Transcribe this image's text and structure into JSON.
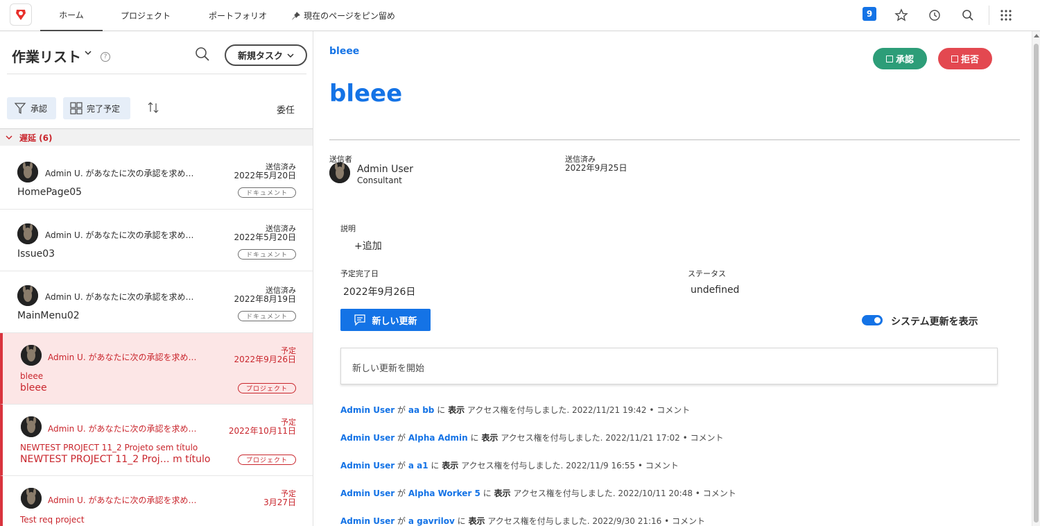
{
  "nav": {
    "tabs": [
      "ホーム",
      "プロジェクト",
      "ポートフォリオ"
    ],
    "pin_label": "現在のページをピン留め",
    "badge_count": "9"
  },
  "worklist": {
    "title": "作業リスト",
    "new_task": "新規タスク",
    "filter_approval": "承認",
    "filter_due": "完了予定",
    "delegate": "委任",
    "group_label": "遅延 (6)",
    "items": [
      {
        "msg": "Admin U. があなたに次の承認を求め…",
        "status1": "送信済み",
        "status2": "2022年5月20日",
        "name": "HomePage05",
        "tag": "ドキュメント"
      },
      {
        "msg": "Admin U. があなたに次の承認を求め…",
        "status1": "送信済み",
        "status2": "2022年5月20日",
        "name": "Issue03",
        "tag": "ドキュメント"
      },
      {
        "msg": "Admin U. があなたに次の承認を求め…",
        "status1": "送信済み",
        "status2": "2022年8月19日",
        "name": "MainMenu02",
        "tag": "ドキュメント"
      },
      {
        "msg": "Admin U. があなたに次の承認を求め…",
        "status1": "予定",
        "status2": "2022年9月26日",
        "sub": "bleee",
        "name": "bleee",
        "tag": "プロジェクト"
      },
      {
        "msg": "Admin U. があなたに次の承認を求め…",
        "status1": "予定",
        "status2": "2022年10月11日",
        "sub": "NEWTEST PROJECT 11_2 Projeto sem título",
        "name": "NEWTEST PROJECT 11_2 Proj…  m título",
        "tag": "プロジェクト"
      },
      {
        "msg": "Admin U. があなたに次の承認を求め…",
        "status1": "予定",
        "status2": "3月27日",
        "sub": "Test req project",
        "name": "",
        "tag": ""
      }
    ]
  },
  "detail": {
    "breadcrumb": "bleee",
    "title": "bleee",
    "approve": "承認",
    "reject": "拒否",
    "sender_label": "送信者",
    "sender_name": "Admin User",
    "sender_role": "Consultant",
    "sent_label": "送信済み",
    "sent_date": "2022年9月25日",
    "desc_label": "説明",
    "desc_add": "+追加",
    "due_label": "予定完了日",
    "due_value": "2022年9月26日",
    "status_label": "ステータス",
    "status_value": "undefined",
    "new_update": "新しい更新",
    "show_system": "システム更新を表示",
    "update_placeholder": "新しい更新を開始",
    "activities": [
      {
        "actor": "Admin User",
        "ga": "が",
        "target": "aa bb",
        "ni": "に",
        "view": "表示",
        "text": "アクセス権を付与しました. 2022/11/21 19:42 •",
        "comment": "コメント"
      },
      {
        "actor": "Admin User",
        "ga": "が",
        "target": "Alpha Admin",
        "ni": "に",
        "view": "表示",
        "text": "アクセス権を付与しました. 2022/11/21 17:02 •",
        "comment": "コメント"
      },
      {
        "actor": "Admin User",
        "ga": "が",
        "target": "a a1",
        "ni": "に",
        "view": "表示",
        "text": "アクセス権を付与しました. 2022/11/9 16:55 •",
        "comment": "コメント"
      },
      {
        "actor": "Admin User",
        "ga": "が",
        "target": "Alpha Worker 5",
        "ni": "に",
        "view": "表示",
        "text": "アクセス権を付与しました. 2022/10/11 20:48 •",
        "comment": "コメント"
      },
      {
        "actor": "Admin User",
        "ga": "が",
        "target": "a gavrilov",
        "ni": "に",
        "view": "表示",
        "text": "アクセス権を付与しました. 2022/9/30 21:16 •",
        "comment": "コメント"
      }
    ]
  }
}
